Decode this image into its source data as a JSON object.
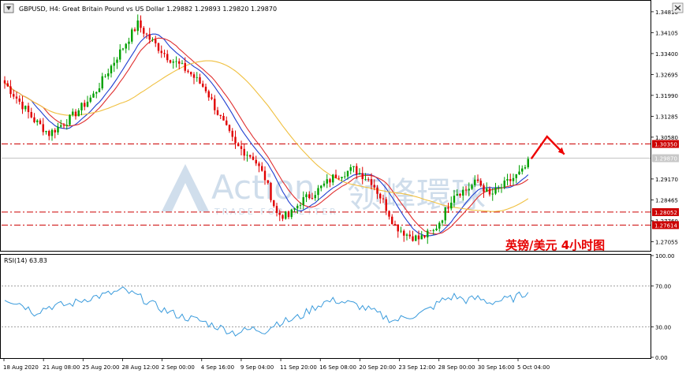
{
  "header": {
    "symbol_line": "GBPUSD, H4:  Great Britain Pound vs US Dollar  1.29882 1.29893 1.29820 1.29870"
  },
  "watermark": {
    "brand_en": "Action",
    "brand_sub": "TRADE FOR BETTER",
    "brand_cn": "领峰環球"
  },
  "annotation": {
    "title_cn": "英镑/美元  4小时图"
  },
  "colors": {
    "bull": "#00a000",
    "bear": "#e00000",
    "ma_fast": "#1f3fd0",
    "ma_mid": "#e03030",
    "ma_slow": "#f0c040",
    "level_line": "#cc0000",
    "arrow": "#ee0000",
    "rsi_line": "#3a9bdc",
    "current_price_bg": "#c8c8c8"
  },
  "chart_data": [
    {
      "type": "candlestick",
      "title": "GBPUSD, H4",
      "ylim": [
        1.268,
        1.351
      ],
      "price_ticks": [
        "1.34810",
        "1.34105",
        "1.33400",
        "1.32695",
        "1.31990",
        "1.31285",
        "1.30580",
        "1.29170",
        "1.28465",
        "1.27760",
        "1.27055"
      ],
      "price_tick_values": [
        1.3481,
        1.34105,
        1.334,
        1.32695,
        1.3199,
        1.31285,
        1.3058,
        1.2917,
        1.28465,
        1.2776,
        1.27055
      ],
      "x_labels": [
        "18 Aug 2020",
        "21 Aug 08:00",
        "25 Aug 20:00",
        "28 Aug 12:00",
        "2 Sep 00:00",
        "4 Sep 16:00",
        "9 Sep 04:00",
        "11 Sep 20:00",
        "16 Sep 08:00",
        "20 Sep 20:00",
        "23 Sep 12:00",
        "28 Sep 00:00",
        "30 Sep 16:00",
        "5 Oct 04:00"
      ],
      "close_anchors": [
        [
          0,
          1.324
        ],
        [
          10,
          1.3115
        ],
        [
          15,
          1.307
        ],
        [
          22,
          1.312
        ],
        [
          30,
          1.32
        ],
        [
          38,
          1.333
        ],
        [
          45,
          1.344
        ],
        [
          49,
          1.339
        ],
        [
          55,
          1.333
        ],
        [
          62,
          1.328
        ],
        [
          68,
          1.322
        ],
        [
          72,
          1.314
        ],
        [
          78,
          1.303
        ],
        [
          84,
          1.299
        ],
        [
          88,
          1.292
        ],
        [
          92,
          1.28
        ],
        [
          96,
          1.279
        ],
        [
          100,
          1.284
        ],
        [
          106,
          1.288
        ],
        [
          112,
          1.293
        ],
        [
          118,
          1.295
        ],
        [
          124,
          1.291
        ],
        [
          128,
          1.284
        ],
        [
          132,
          1.276
        ],
        [
          136,
          1.273
        ],
        [
          140,
          1.2715
        ],
        [
          145,
          1.274
        ],
        [
          148,
          1.279
        ],
        [
          152,
          1.287
        ],
        [
          156,
          1.288
        ],
        [
          160,
          1.291
        ],
        [
          164,
          1.286
        ],
        [
          168,
          1.289
        ],
        [
          172,
          1.292
        ],
        [
          175,
          1.294
        ],
        [
          177,
          1.297
        ]
      ],
      "series": [
        {
          "name": "MA fast",
          "role": "ma_fast"
        },
        {
          "name": "MA mid",
          "role": "ma_mid"
        },
        {
          "name": "MA slow",
          "role": "ma_slow"
        }
      ],
      "horizontal_levels": [
        {
          "value": 1.3035,
          "label": "1.30350",
          "style": "dash-dot"
        },
        {
          "value": 1.28052,
          "label": "1.28052",
          "style": "dash-dot"
        },
        {
          "value": 1.27614,
          "label": "1.27614",
          "style": "dash-dot"
        }
      ],
      "current_price": {
        "value": 1.2987,
        "label": "1.29870"
      },
      "projection": {
        "from": 1.2985,
        "peak": 1.306,
        "to": 1.3
      }
    },
    {
      "type": "line",
      "title": "RSI(14) 63.83",
      "indicator": "RSI(14)",
      "last_value": 63.83,
      "ylim": [
        0,
        100
      ],
      "y_ticks": [
        "100.00",
        "70.00",
        "30.00",
        "0.00"
      ],
      "y_tick_values": [
        100,
        70,
        30,
        0
      ],
      "reference_levels": [
        70,
        30
      ],
      "anchors": [
        [
          0,
          58
        ],
        [
          6,
          52
        ],
        [
          10,
          44
        ],
        [
          15,
          50
        ],
        [
          22,
          52
        ],
        [
          28,
          58
        ],
        [
          35,
          62
        ],
        [
          40,
          66
        ],
        [
          45,
          60
        ],
        [
          50,
          52
        ],
        [
          55,
          45
        ],
        [
          60,
          40
        ],
        [
          66,
          36
        ],
        [
          72,
          30
        ],
        [
          78,
          24
        ],
        [
          84,
          28
        ],
        [
          88,
          26
        ],
        [
          92,
          34
        ],
        [
          96,
          36
        ],
        [
          100,
          40
        ],
        [
          104,
          48
        ],
        [
          108,
          54
        ],
        [
          112,
          56
        ],
        [
          118,
          52
        ],
        [
          124,
          46
        ],
        [
          128,
          40
        ],
        [
          132,
          36
        ],
        [
          136,
          40
        ],
        [
          140,
          42
        ],
        [
          144,
          48
        ],
        [
          148,
          56
        ],
        [
          152,
          60
        ],
        [
          156,
          56
        ],
        [
          160,
          58
        ],
        [
          164,
          54
        ],
        [
          168,
          56
        ],
        [
          172,
          58
        ],
        [
          177,
          63.83
        ]
      ]
    }
  ]
}
